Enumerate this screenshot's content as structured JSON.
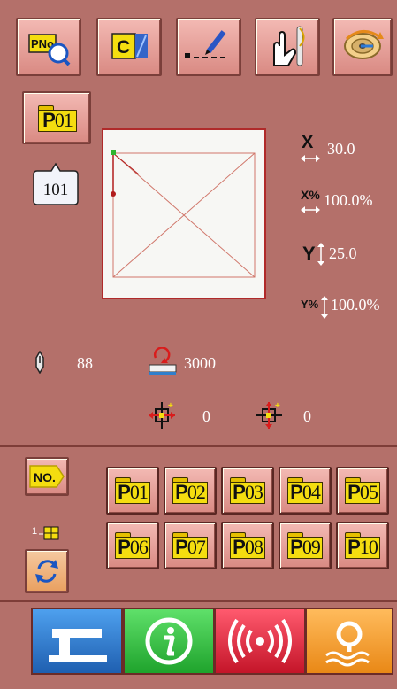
{
  "toolbar": {
    "items": [
      {
        "name": "pattern-search-button",
        "text": "PNo"
      },
      {
        "name": "clear-button",
        "text": "C"
      },
      {
        "name": "edit-settings-button",
        "text": ""
      },
      {
        "name": "manual-needle-button",
        "text": ""
      },
      {
        "name": "bobbin-winding-button",
        "text": ""
      }
    ]
  },
  "pattern": {
    "current_label": "P01",
    "number_bubble": "101"
  },
  "scales": {
    "x_label": "X",
    "x_value": "30.0",
    "x_pct_label": "X%",
    "x_pct_value": "100.0%",
    "y_label": "Y",
    "y_value": "25.0",
    "y_pct_label": "Y%",
    "y_pct_value": "100.0%"
  },
  "status": {
    "needle_value": "88",
    "speed_value": "3000",
    "origin_x_value": "0",
    "origin_y_value": "0"
  },
  "selector": {
    "no_label": "NO.",
    "grid_label": "1",
    "patterns": [
      "P01",
      "P02",
      "P03",
      "P04",
      "P05",
      "P06",
      "P07",
      "P08",
      "P09",
      "P10"
    ]
  },
  "colors": {
    "background": "#b4706a",
    "folder_yellow": "#f4dd10",
    "sew_blue": "#2f7fcc",
    "info_green": "#2fbf3a",
    "signal_red": "#d9273c",
    "search_orange": "#f29a2e"
  }
}
